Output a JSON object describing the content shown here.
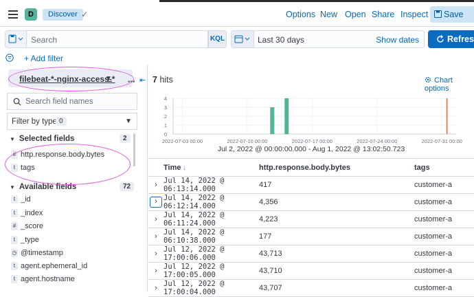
{
  "header": {
    "avatar_letter": "D",
    "breadcrumb": "Discover",
    "nav": [
      "Options",
      "New",
      "Open",
      "Share",
      "Inspect"
    ],
    "save_label": "Save"
  },
  "query": {
    "search_placeholder": "Search",
    "language": "KQL",
    "date_range": "Last 30 days",
    "show_dates": "Show dates",
    "refresh_label": "Refresh",
    "add_filter": "+ Add filter"
  },
  "sidebar": {
    "index_pattern": "filebeat-*-nginx-access-*",
    "field_search_placeholder": "Search field names",
    "filter_by_type": "Filter by type",
    "filter_count": "0",
    "selected_label": "Selected fields",
    "selected_count": "2",
    "selected_fields": [
      {
        "type": "#",
        "name": "http.response.body.bytes"
      },
      {
        "type": "t",
        "name": "tags"
      }
    ],
    "available_label": "Available fields",
    "available_count": "72",
    "available_fields": [
      {
        "type": "t",
        "name": "_id"
      },
      {
        "type": "t",
        "name": "_index"
      },
      {
        "type": "#",
        "name": "_score"
      },
      {
        "type": "t",
        "name": "_type"
      },
      {
        "type": "clock",
        "name": "@timestamp"
      },
      {
        "type": "t",
        "name": "agent.ephemeral_id"
      },
      {
        "type": "t",
        "name": "agent.hostname"
      }
    ]
  },
  "main": {
    "hits_count": "7",
    "hits_label": "hits",
    "chart_options": "Chart options",
    "time_range": "Jul 2, 2022 @ 00:00:00.000 - Aug 1, 2022 @ 13:02:50.723",
    "columns": [
      "Time",
      "http.response.body.bytes",
      "tags"
    ],
    "rows": [
      {
        "time": "Jul 14, 2022 @ 06:13:14.000",
        "bytes": "417",
        "tags": "customer-a"
      },
      {
        "time": "Jul 14, 2022 @ 06:12:14.000",
        "bytes": "4,356",
        "tags": "customer-a"
      },
      {
        "time": "Jul 14, 2022 @ 06:11:24.000",
        "bytes": "4,223",
        "tags": "customer-a"
      },
      {
        "time": "Jul 14, 2022 @ 06:10:38.000",
        "bytes": "177",
        "tags": "customer-a"
      },
      {
        "time": "Jul 12, 2022 @ 17:00:06.000",
        "bytes": "43,713",
        "tags": "customer-a"
      },
      {
        "time": "Jul 12, 2022 @ 17:00:05.000",
        "bytes": "43,710",
        "tags": "customer-a"
      },
      {
        "time": "Jul 12, 2022 @ 17:00:04.000",
        "bytes": "43,707",
        "tags": "customer-a"
      }
    ]
  },
  "colors": {
    "bar": "#54b399",
    "now_marker": "#e7664c",
    "primary": "#006bb8",
    "annotation": "#e353e3"
  },
  "chart_data": {
    "type": "bar",
    "x_ticks": [
      "2022-07-03 00:00",
      "2022-07-10 00:00",
      "2022-07-17 00:00",
      "2022-07-24 00:00",
      "2022-07-31 00:00"
    ],
    "y_ticks": [
      0,
      1,
      2,
      3,
      4
    ],
    "ylim": [
      0,
      4
    ],
    "x_range_days": [
      0,
      30.54
    ],
    "bars": [
      {
        "day": 10.7,
        "value": 3
      },
      {
        "day": 12.25,
        "value": 4
      }
    ],
    "now_marker_day": 29.55
  }
}
